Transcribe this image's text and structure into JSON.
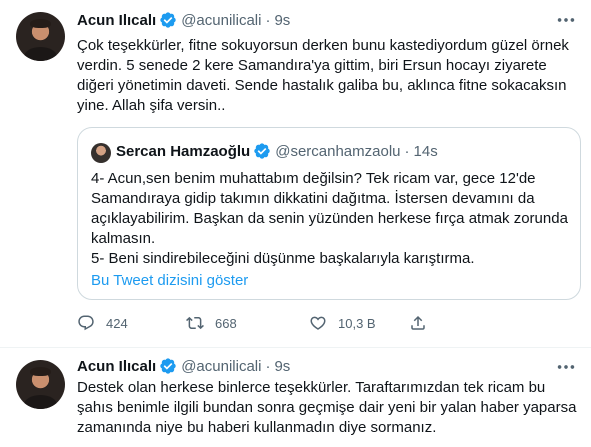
{
  "tweets": [
    {
      "name": "Acun Ilıcalı",
      "handle": "@acunilicali",
      "dot": "·",
      "time": "9s",
      "text": "Çok teşekkürler, fitne sokuyorsun derken bunu kastediyordum güzel örnek verdin. 5 senede 2 kere Samandıra'ya gittim, biri Ersun hocayı ziyarete diğeri yönetimin daveti. Sende hastalık galiba bu, aklınca fitne sokacaksın yine. Allah şifa versin..",
      "quote": {
        "name": "Sercan Hamzaoğlu",
        "handle": "@sercanhamzaolu",
        "dot": "·",
        "time": "14s",
        "text": "4- Acun,sen benim muhattabım değilsin? Tek ricam var, gece 12'de Samandıraya gidip takımın dikkatini dağıtma. İstersen devamını da açıklayabilirim. Başkan da senin yüzünden herkese fırça atmak zorunda kalmasın.\n5- Beni sindirebileceğini düşünme başkalarıyla karıştırma.",
        "link": "Bu Tweet dizisini göster"
      },
      "actions": {
        "reply_count": "424",
        "retweet_count": "668",
        "like_count": "10,3 B"
      }
    },
    {
      "name": "Acun Ilıcalı",
      "handle": "@acunilicali",
      "dot": "·",
      "time": "9s",
      "text": "Destek olan herkese binlerce teşekkürler. Taraftarımızdan tek ricam bu şahıs benimle ilgili bundan sonra geçmişe dair yeni bir yalan haber yaparsa zamanında niye bu haberi kullanmadın diye sormanız."
    }
  ],
  "colors": {
    "accent": "#1d9bf0",
    "secondary_text": "#536471",
    "border": "#cfd9de"
  },
  "icons": [
    "more-icon",
    "verified-badge-icon",
    "reply-icon",
    "retweet-icon",
    "like-icon",
    "share-icon"
  ]
}
